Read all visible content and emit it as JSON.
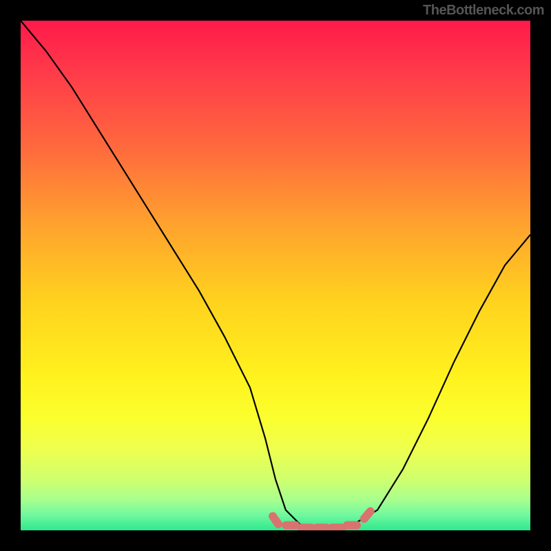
{
  "watermark": "TheBottleneck.com",
  "chart_data": {
    "type": "line",
    "title": "",
    "xlabel": "",
    "ylabel": "",
    "xlim": [
      0,
      100
    ],
    "ylim": [
      0,
      100
    ],
    "series": [
      {
        "name": "bottleneck-curve",
        "x": [
          0,
          5,
          10,
          15,
          20,
          25,
          30,
          35,
          40,
          45,
          48,
          50,
          52,
          55,
          60,
          63,
          65,
          70,
          75,
          80,
          85,
          90,
          95,
          100
        ],
        "y": [
          100,
          94,
          87,
          79,
          71,
          63,
          55,
          47,
          38,
          28,
          18,
          10,
          4,
          1,
          0,
          0,
          1,
          4,
          12,
          22,
          33,
          43,
          52,
          58
        ]
      },
      {
        "name": "sweet-spot-markers",
        "x": [
          50,
          53,
          56,
          59,
          62,
          65,
          68
        ],
        "y": [
          2,
          1,
          0.5,
          0.5,
          0.5,
          1,
          3
        ]
      }
    ],
    "gradient_stops": [
      {
        "offset": 0.0,
        "color": "#ff1a4a"
      },
      {
        "offset": 0.1,
        "color": "#ff3a4a"
      },
      {
        "offset": 0.25,
        "color": "#ff6a3d"
      },
      {
        "offset": 0.4,
        "color": "#ffa22e"
      },
      {
        "offset": 0.55,
        "color": "#ffd21e"
      },
      {
        "offset": 0.7,
        "color": "#fff21e"
      },
      {
        "offset": 0.78,
        "color": "#fbff2e"
      },
      {
        "offset": 0.84,
        "color": "#eeff4e"
      },
      {
        "offset": 0.9,
        "color": "#cfff6e"
      },
      {
        "offset": 0.94,
        "color": "#a8ff8e"
      },
      {
        "offset": 0.97,
        "color": "#70f89e"
      },
      {
        "offset": 1.0,
        "color": "#2ee88e"
      }
    ],
    "marker_color": "#d9736f",
    "curve_color": "#000000"
  }
}
